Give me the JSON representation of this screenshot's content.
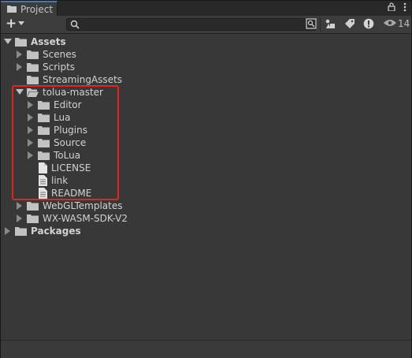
{
  "tab": {
    "title": "Project",
    "icon": "folder-icon"
  },
  "tab_tools": {
    "lock_icon": "lock-icon",
    "menu_icon": "kebab-menu-icon"
  },
  "toolbar": {
    "add_label": "+",
    "search_placeholder": "",
    "hidden_count": "14",
    "icons": [
      "search-by-type-icon",
      "search-by-label-icon",
      "favorites-icon",
      "warnings-icon",
      "visibility-icon"
    ]
  },
  "tree": {
    "assets": "Assets",
    "scenes": "Scenes",
    "scripts": "Scripts",
    "streaming_assets": "StreamingAssets",
    "tolua_master": "tolua-master",
    "editor": "Editor",
    "lua": "Lua",
    "plugins": "Plugins",
    "source": "Source",
    "tolua": "ToLua",
    "license": "LICENSE",
    "link": "link",
    "readme": "README",
    "webgl_templates": "WebGLTemplates",
    "wx_wasm": "WX-WASM-SDK-V2",
    "packages": "Packages"
  },
  "colors": {
    "accent": "#3a79bb",
    "highlight": "#e2261f",
    "panel": "#383838"
  }
}
